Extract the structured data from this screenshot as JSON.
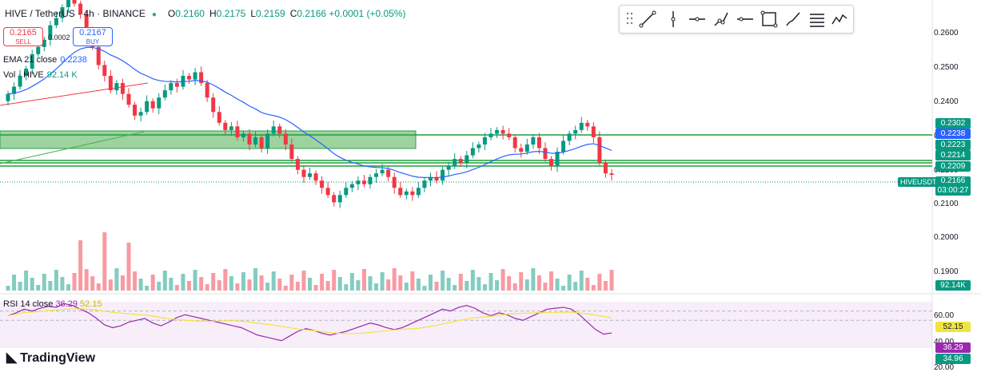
{
  "header": {
    "symbol": "HIVE / TetherUS · 4h · BINANCE",
    "open_key": "O",
    "open": "0.2160",
    "high_key": "H",
    "high": "0.2175",
    "low_key": "L",
    "low": "0.2159",
    "close_key": "C",
    "close": "0.2166",
    "change": "+0.0001 (+0.05%)"
  },
  "trade": {
    "sell_price": "0.2165",
    "sell_label": "SELL",
    "buy_price": "0.2167",
    "buy_label": "BUY",
    "spread": "0.0002"
  },
  "indicators": {
    "ema_label": "EMA 21 close",
    "ema_value": "0.2238",
    "vol_label": "Vol · HIVE",
    "vol_value": "92.14 K",
    "rsi_label": "RSI 14 close",
    "rsi_value": "36.29",
    "rsi_ma_value": "52.15"
  },
  "toolbar": {
    "tools": [
      "drag-handle-icon",
      "trend-line-icon",
      "vertical-line-icon",
      "horizontal-ray-icon",
      "path-icon",
      "horizontal-line-icon",
      "rectangle-icon",
      "brush-icon",
      "text-lines-icon",
      "pattern-icon"
    ]
  },
  "axis": {
    "ticks": [
      "0.2600",
      "0.2500",
      "0.2400",
      "0.2300",
      "0.2200",
      "0.2100",
      "0.2000",
      "0.1900"
    ],
    "rsi_ticks": [
      "60.00",
      "40.00",
      "20.00"
    ]
  },
  "tags": {
    "t1": "0.2302",
    "t2": "0.2238",
    "t3": "0.2223",
    "t4": "0.2214",
    "t5": "0.2209",
    "pair": "HIVEUSDT",
    "last": "0.2166",
    "countdown": "03:00:27",
    "vol": "92.14K",
    "rsi_ma": "52.15",
    "rsi": "36.29",
    "rsi_low": "34.96"
  },
  "brand": {
    "name": "TradingView"
  },
  "colors": {
    "up": "#089981",
    "down": "#f23645",
    "ema": "#2962ff",
    "zone": "#4caf50",
    "rsi": "#9c27b0",
    "rsi_ma": "#f0e442"
  },
  "chart_data": {
    "type": "candlestick",
    "ylim": [
      0.185,
      0.265
    ],
    "closes": [
      0.239,
      0.241,
      0.244,
      0.246,
      0.25,
      0.252,
      0.254,
      0.258,
      0.26,
      0.263,
      0.266,
      0.264,
      0.261,
      0.256,
      0.252,
      0.247,
      0.244,
      0.24,
      0.242,
      0.239,
      0.236,
      0.233,
      0.234,
      0.237,
      0.235,
      0.238,
      0.24,
      0.242,
      0.241,
      0.244,
      0.243,
      0.245,
      0.242,
      0.238,
      0.234,
      0.231,
      0.229,
      0.23,
      0.227,
      0.228,
      0.225,
      0.227,
      0.224,
      0.228,
      0.23,
      0.228,
      0.225,
      0.221,
      0.218,
      0.216,
      0.217,
      0.215,
      0.213,
      0.211,
      0.209,
      0.211,
      0.213,
      0.214,
      0.215,
      0.214,
      0.216,
      0.217,
      0.218,
      0.216,
      0.213,
      0.211,
      0.212,
      0.211,
      0.213,
      0.215,
      0.216,
      0.215,
      0.218,
      0.219,
      0.221,
      0.22,
      0.222,
      0.224,
      0.225,
      0.227,
      0.228,
      0.229,
      0.228,
      0.227,
      0.224,
      0.223,
      0.225,
      0.227,
      0.224,
      0.221,
      0.219,
      0.223,
      0.226,
      0.228,
      0.229,
      0.231,
      0.23,
      0.227,
      0.22,
      0.217,
      0.2166
    ],
    "rsi": [
      55,
      58,
      62,
      60,
      63,
      65,
      64,
      68,
      66,
      62,
      58,
      52,
      45,
      42,
      44,
      48,
      50,
      52,
      47,
      44,
      48,
      53,
      56,
      54,
      52,
      50,
      48,
      46,
      44,
      42,
      38,
      34,
      32,
      30,
      28,
      33,
      38,
      41,
      39,
      36,
      34,
      36,
      38,
      41,
      44,
      47,
      45,
      42,
      40,
      42,
      46,
      50,
      54,
      58,
      62,
      60,
      64,
      66,
      63,
      58,
      55,
      58,
      56,
      52,
      50,
      54,
      58,
      62,
      63,
      64,
      62,
      56,
      48,
      40,
      35,
      36.29
    ]
  }
}
